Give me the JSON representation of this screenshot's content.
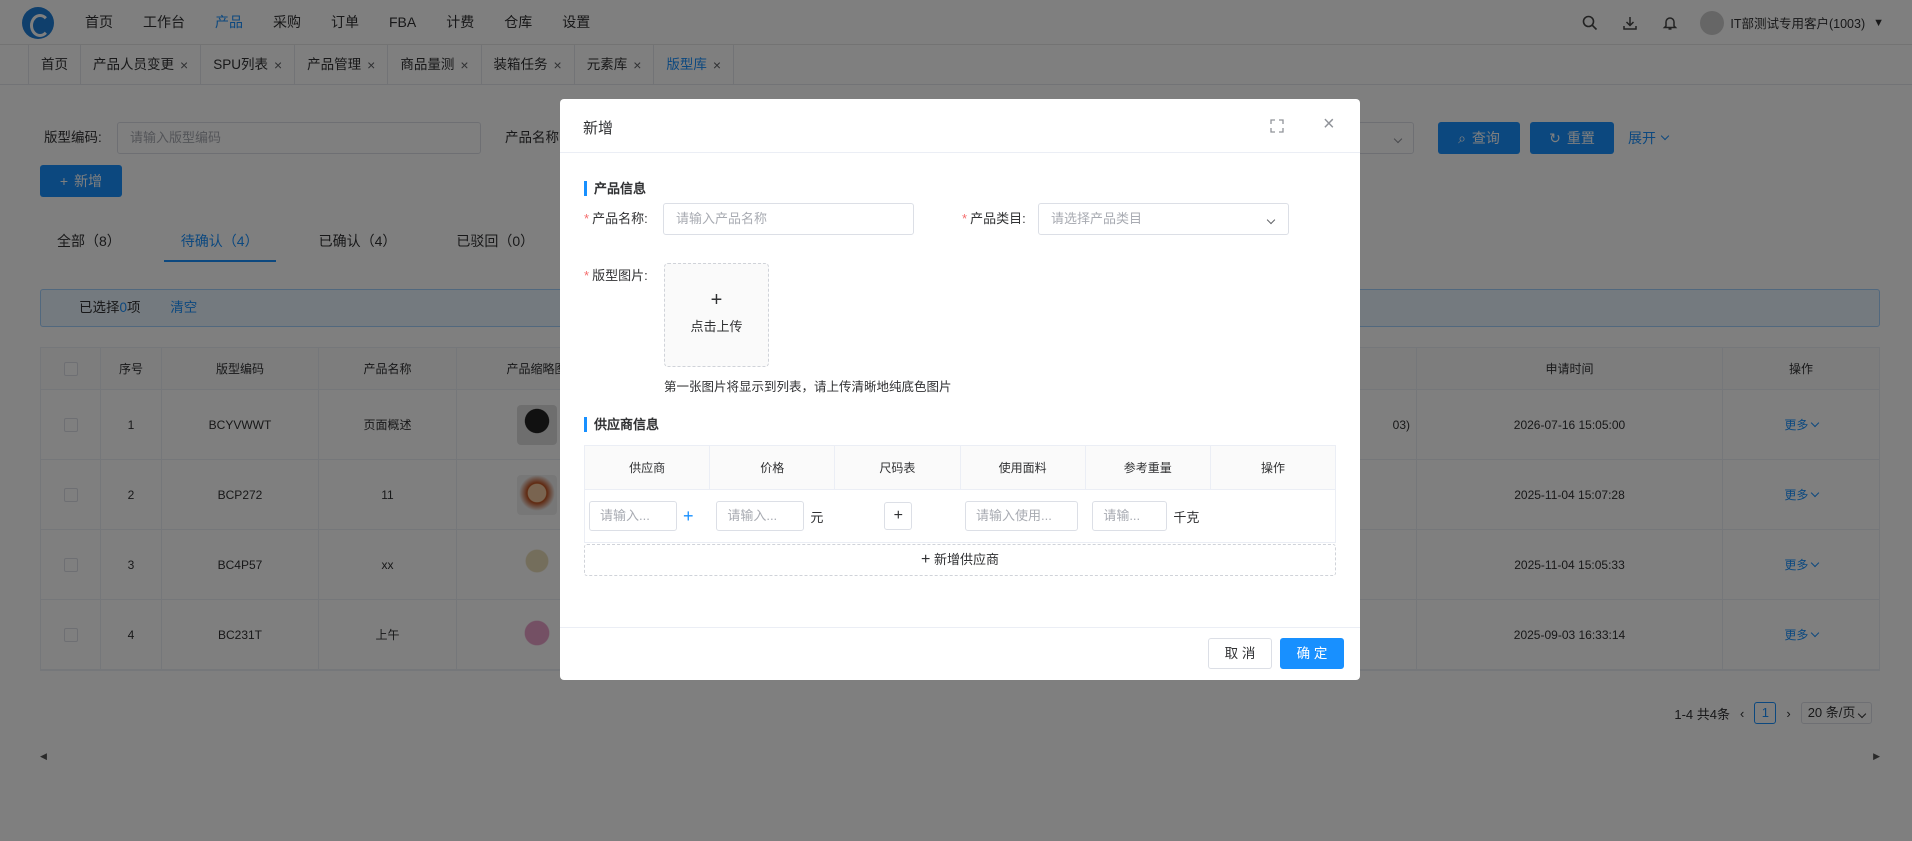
{
  "nav": {
    "menu": [
      "首页",
      "工作台",
      "产品",
      "采购",
      "订单",
      "FBA",
      "计费",
      "仓库",
      "设置"
    ],
    "active_menu": "产品",
    "user": "IT部测试专用客户(1003)"
  },
  "tabs": [
    {
      "label": "首页",
      "closable": false
    },
    {
      "label": "产品人员变更",
      "closable": true
    },
    {
      "label": "SPU列表",
      "closable": true
    },
    {
      "label": "产品管理",
      "closable": true
    },
    {
      "label": "商品量测",
      "closable": true
    },
    {
      "label": "装箱任务",
      "closable": true
    },
    {
      "label": "元素库",
      "closable": true
    },
    {
      "label": "版型库",
      "closable": true
    }
  ],
  "filters": {
    "code_label": "版型编码:",
    "code_placeholder": "请输入版型编码",
    "name_label": "产品名称",
    "query_button": "查询",
    "reset_button": "重置",
    "expand_button": "展开"
  },
  "add_button": "新增",
  "status_tabs": [
    "全部（8）",
    "待确认（4）",
    "已确认（4）",
    "已驳回（0）"
  ],
  "selection": {
    "prefix": "已选择",
    "count": "0",
    "suffix": "项",
    "clear": "清空"
  },
  "table": {
    "headers": [
      "",
      "序号",
      "版型编码",
      "产品名称",
      "产品缩略图",
      "",
      "申请时间",
      "操作"
    ],
    "rows": [
      {
        "index": "1",
        "code": "BCYVWWT",
        "name": "页面概述",
        "extra": "03)",
        "time": "2026-07-16 15:05:00",
        "action": "更多"
      },
      {
        "index": "2",
        "code": "BCP272",
        "name": "11",
        "extra": "",
        "time": "2025-11-04 15:07:28",
        "action": "更多"
      },
      {
        "index": "3",
        "code": "BC4P57",
        "name": "xx",
        "extra": "",
        "time": "2025-11-04 15:05:33",
        "action": "更多"
      },
      {
        "index": "4",
        "code": "BC231T",
        "name": "上午",
        "extra": "",
        "time": "2025-09-03 16:33:14",
        "action": "更多"
      }
    ]
  },
  "pagination": {
    "total": "1-4 共4条",
    "current": "1",
    "size": "20 条/页"
  },
  "dialog": {
    "title": "新增",
    "product_section": "产品信息",
    "name_label": "产品名称:",
    "name_placeholder": "请输入产品名称",
    "category_label": "产品类目:",
    "category_placeholder": "请选择产品类目",
    "image_label": "版型图片:",
    "upload_text": "点击上传",
    "upload_tip": "第一张图片将显示到列表，请上传清晰地纯底色图片",
    "supplier_section": "供应商信息",
    "supplier_headers": [
      "供应商",
      "价格",
      "尺码表",
      "使用面料",
      "参考重量",
      "操作"
    ],
    "supplier_placeholder": "请输入...",
    "price_placeholder": "请输入...",
    "price_unit": "元",
    "fabric_placeholder": "请输入使用...",
    "weight_placeholder": "请输...",
    "weight_unit": "千克",
    "add_supplier": "新增供应商",
    "cancel": "取 消",
    "confirm": "确 定"
  }
}
